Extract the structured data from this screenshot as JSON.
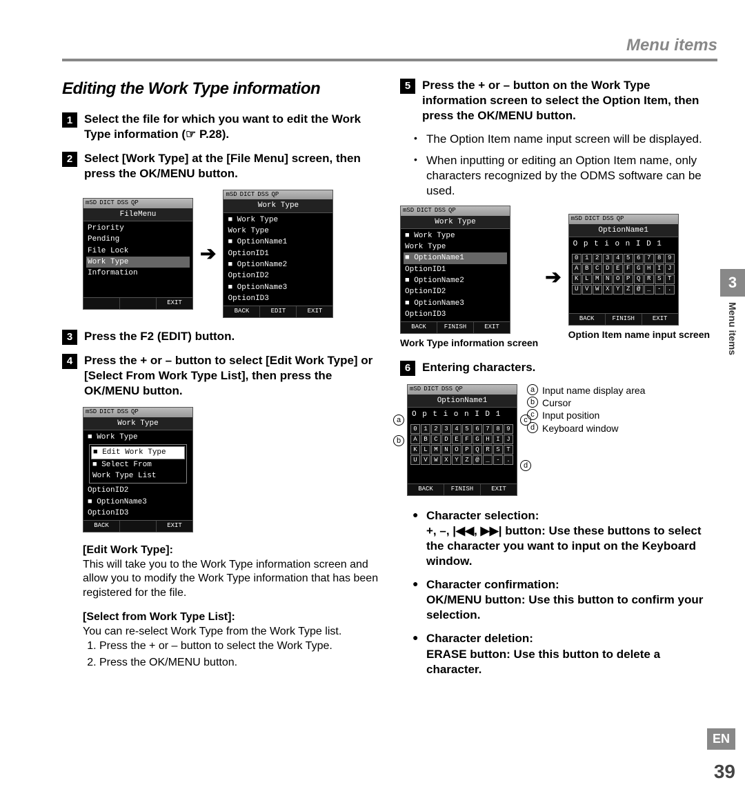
{
  "header": "Menu items",
  "section_title": "Editing the Work Type information",
  "steps": {
    "s1": "Select the file for which you want to edit the Work Type information (☞ P.28).",
    "s2": "Select [Work Type] at the [File Menu] screen, then press the OK/MENU button.",
    "s3": "Press the F2 (EDIT) button.",
    "s4": "Press the + or – button to select [Edit Work Type] or [Select From Work Type List], then press the OK/MENU button.",
    "s5": "Press the + or – button on the Work Type information screen to select the Option Item, then press the OK/MENU button.",
    "s6": "Entering characters."
  },
  "screen1": {
    "title": "FileMenu",
    "items": [
      "Priority",
      "Pending",
      "File Lock",
      "Work Type",
      "Information"
    ],
    "hl": "Work Type",
    "foot": [
      "",
      "",
      "EXIT"
    ]
  },
  "screen2": {
    "title": "Work Type",
    "items": [
      "■ Work Type",
      "  Work Type",
      "■ OptionName1",
      "  OptionID1",
      "■ OptionName2",
      "  OptionID2",
      "■ OptionName3",
      "  OptionID3"
    ],
    "foot": [
      "BACK",
      "EDIT",
      "EXIT"
    ]
  },
  "screen3": {
    "title": "Work Type",
    "top": "■ Work Type",
    "dialog_hl": "■ Edit Work Type",
    "dialog_items": [
      "■ Select From",
      "  Work Type List"
    ],
    "below": [
      "  OptionID2",
      "■ OptionName3",
      "  OptionID3"
    ],
    "foot": [
      "BACK",
      "",
      "EXIT"
    ]
  },
  "screen4": {
    "title": "Work Type",
    "items": [
      "■ Work Type",
      "  Work Type",
      "■ OptionName1",
      "  OptionID1",
      "■ OptionName2",
      "  OptionID2",
      "■ OptionName3",
      "  OptionID3"
    ],
    "hl": "■ OptionName1",
    "foot": [
      "BACK",
      "FINISH",
      "EXIT"
    ]
  },
  "screen5": {
    "title": "OptionName1",
    "input": "O p t i o n I D 1",
    "foot": [
      "BACK",
      "FINISH",
      "EXIT"
    ]
  },
  "kb": [
    [
      "0",
      "1",
      "2",
      "3",
      "4",
      "5",
      "6",
      "7",
      "8",
      "9"
    ],
    [
      "A",
      "B",
      "C",
      "D",
      "E",
      "F",
      "G",
      "H",
      "I",
      "J"
    ],
    [
      "K",
      "L",
      "M",
      "N",
      "O",
      "P",
      "Q",
      "R",
      "S",
      "T"
    ],
    [
      "U",
      "V",
      "W",
      "X",
      "Y",
      "Z",
      "@",
      "_",
      "-",
      "."
    ]
  ],
  "edit_label": "[Edit Work Type]:",
  "edit_text": "This will take you to the Work Type information screen and allow you to modify the Work Type information that has been registered for the file.",
  "select_label": "[Select from Work Type List]:",
  "select_text": "You can re-select Work Type from the Work Type list.",
  "select_sub1": "Press the + or – button to select the Work Type.",
  "select_sub2": "Press the OK/MENU button.",
  "bullets5": [
    "The Option Item name input screen will be displayed.",
    "When inputting or editing an Option Item name, only characters recognized by the ODMS software can be used."
  ],
  "caption1": "Work Type information screen",
  "caption2": "Option Item name input screen",
  "legend": {
    "a": "Input name display area",
    "b": "Cursor",
    "c": "Input position",
    "d": "Keyboard window"
  },
  "char_sel_title": "Character selection:",
  "char_sel_text": "+, –, |◀◀, ▶▶| button: Use these buttons to select the character you want to input on the Keyboard window.",
  "char_conf_title": "Character confirmation:",
  "char_conf_text": "OK/MENU button: Use this button to confirm your selection.",
  "char_del_title": "Character deletion:",
  "char_del_text": "ERASE button: Use this button to delete a character.",
  "tab_num": "3",
  "tab_text": "Menu items",
  "lang": "EN",
  "page": "39"
}
